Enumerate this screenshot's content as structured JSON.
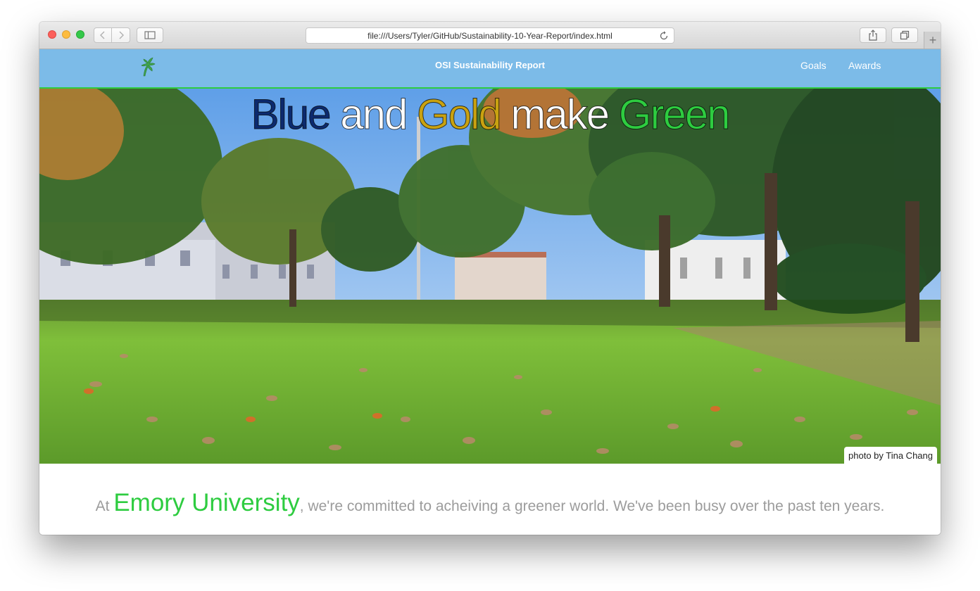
{
  "browser": {
    "url": "file:///Users/Tyler/GitHub/Sustainability-10-Year-Report/index.html",
    "new_tab_label": "+"
  },
  "site": {
    "title": "OSI Sustainability Report",
    "nav": [
      {
        "label": "Goals"
      },
      {
        "label": "Awards"
      }
    ]
  },
  "hero": {
    "headline": {
      "word1": "Blue",
      "word2": "and",
      "word3": "Gold",
      "word4": "make",
      "word5": "Green"
    },
    "credit": "photo by Tina Chang"
  },
  "intro": {
    "prefix": "At",
    "highlight": "Emory University",
    "suffix": ", we're committed to acheiving a greener world. We've been busy over the past ten years."
  },
  "colors": {
    "nav_bg": "#7cbbe8",
    "accent_green": "#2ecc40",
    "emory_blue": "#0c2a6e",
    "emory_gold": "#c9a211",
    "body_text": "#9c9c9c"
  },
  "icons": {
    "logo": "leaf-logo-icon",
    "back": "chevron-left-icon",
    "forward": "chevron-right-icon",
    "sidebar": "sidebar-icon",
    "reload": "reload-icon",
    "share": "share-icon",
    "tabs": "tabs-icon"
  }
}
